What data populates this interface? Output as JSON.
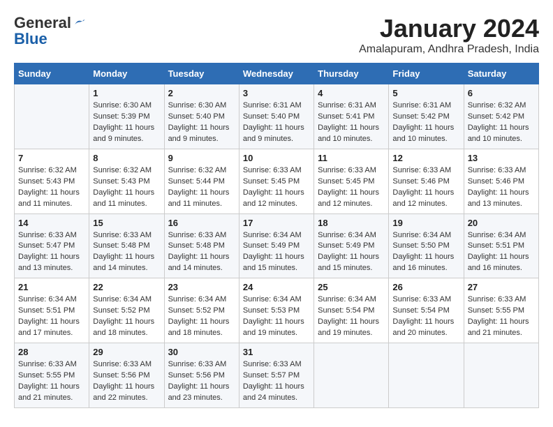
{
  "header": {
    "logo_general": "General",
    "logo_blue": "Blue",
    "main_title": "January 2024",
    "subtitle": "Amalapuram, Andhra Pradesh, India"
  },
  "columns": [
    "Sunday",
    "Monday",
    "Tuesday",
    "Wednesday",
    "Thursday",
    "Friday",
    "Saturday"
  ],
  "weeks": [
    [
      {
        "day": "",
        "info": ""
      },
      {
        "day": "1",
        "info": "Sunrise: 6:30 AM\nSunset: 5:39 PM\nDaylight: 11 hours\nand 9 minutes."
      },
      {
        "day": "2",
        "info": "Sunrise: 6:30 AM\nSunset: 5:40 PM\nDaylight: 11 hours\nand 9 minutes."
      },
      {
        "day": "3",
        "info": "Sunrise: 6:31 AM\nSunset: 5:40 PM\nDaylight: 11 hours\nand 9 minutes."
      },
      {
        "day": "4",
        "info": "Sunrise: 6:31 AM\nSunset: 5:41 PM\nDaylight: 11 hours\nand 10 minutes."
      },
      {
        "day": "5",
        "info": "Sunrise: 6:31 AM\nSunset: 5:42 PM\nDaylight: 11 hours\nand 10 minutes."
      },
      {
        "day": "6",
        "info": "Sunrise: 6:32 AM\nSunset: 5:42 PM\nDaylight: 11 hours\nand 10 minutes."
      }
    ],
    [
      {
        "day": "7",
        "info": "Sunrise: 6:32 AM\nSunset: 5:43 PM\nDaylight: 11 hours\nand 11 minutes."
      },
      {
        "day": "8",
        "info": "Sunrise: 6:32 AM\nSunset: 5:43 PM\nDaylight: 11 hours\nand 11 minutes."
      },
      {
        "day": "9",
        "info": "Sunrise: 6:32 AM\nSunset: 5:44 PM\nDaylight: 11 hours\nand 11 minutes."
      },
      {
        "day": "10",
        "info": "Sunrise: 6:33 AM\nSunset: 5:45 PM\nDaylight: 11 hours\nand 12 minutes."
      },
      {
        "day": "11",
        "info": "Sunrise: 6:33 AM\nSunset: 5:45 PM\nDaylight: 11 hours\nand 12 minutes."
      },
      {
        "day": "12",
        "info": "Sunrise: 6:33 AM\nSunset: 5:46 PM\nDaylight: 11 hours\nand 12 minutes."
      },
      {
        "day": "13",
        "info": "Sunrise: 6:33 AM\nSunset: 5:46 PM\nDaylight: 11 hours\nand 13 minutes."
      }
    ],
    [
      {
        "day": "14",
        "info": "Sunrise: 6:33 AM\nSunset: 5:47 PM\nDaylight: 11 hours\nand 13 minutes."
      },
      {
        "day": "15",
        "info": "Sunrise: 6:33 AM\nSunset: 5:48 PM\nDaylight: 11 hours\nand 14 minutes."
      },
      {
        "day": "16",
        "info": "Sunrise: 6:33 AM\nSunset: 5:48 PM\nDaylight: 11 hours\nand 14 minutes."
      },
      {
        "day": "17",
        "info": "Sunrise: 6:34 AM\nSunset: 5:49 PM\nDaylight: 11 hours\nand 15 minutes."
      },
      {
        "day": "18",
        "info": "Sunrise: 6:34 AM\nSunset: 5:49 PM\nDaylight: 11 hours\nand 15 minutes."
      },
      {
        "day": "19",
        "info": "Sunrise: 6:34 AM\nSunset: 5:50 PM\nDaylight: 11 hours\nand 16 minutes."
      },
      {
        "day": "20",
        "info": "Sunrise: 6:34 AM\nSunset: 5:51 PM\nDaylight: 11 hours\nand 16 minutes."
      }
    ],
    [
      {
        "day": "21",
        "info": "Sunrise: 6:34 AM\nSunset: 5:51 PM\nDaylight: 11 hours\nand 17 minutes."
      },
      {
        "day": "22",
        "info": "Sunrise: 6:34 AM\nSunset: 5:52 PM\nDaylight: 11 hours\nand 18 minutes."
      },
      {
        "day": "23",
        "info": "Sunrise: 6:34 AM\nSunset: 5:52 PM\nDaylight: 11 hours\nand 18 minutes."
      },
      {
        "day": "24",
        "info": "Sunrise: 6:34 AM\nSunset: 5:53 PM\nDaylight: 11 hours\nand 19 minutes."
      },
      {
        "day": "25",
        "info": "Sunrise: 6:34 AM\nSunset: 5:54 PM\nDaylight: 11 hours\nand 19 minutes."
      },
      {
        "day": "26",
        "info": "Sunrise: 6:33 AM\nSunset: 5:54 PM\nDaylight: 11 hours\nand 20 minutes."
      },
      {
        "day": "27",
        "info": "Sunrise: 6:33 AM\nSunset: 5:55 PM\nDaylight: 11 hours\nand 21 minutes."
      }
    ],
    [
      {
        "day": "28",
        "info": "Sunrise: 6:33 AM\nSunset: 5:55 PM\nDaylight: 11 hours\nand 21 minutes."
      },
      {
        "day": "29",
        "info": "Sunrise: 6:33 AM\nSunset: 5:56 PM\nDaylight: 11 hours\nand 22 minutes."
      },
      {
        "day": "30",
        "info": "Sunrise: 6:33 AM\nSunset: 5:56 PM\nDaylight: 11 hours\nand 23 minutes."
      },
      {
        "day": "31",
        "info": "Sunrise: 6:33 AM\nSunset: 5:57 PM\nDaylight: 11 hours\nand 24 minutes."
      },
      {
        "day": "",
        "info": ""
      },
      {
        "day": "",
        "info": ""
      },
      {
        "day": "",
        "info": ""
      }
    ]
  ]
}
